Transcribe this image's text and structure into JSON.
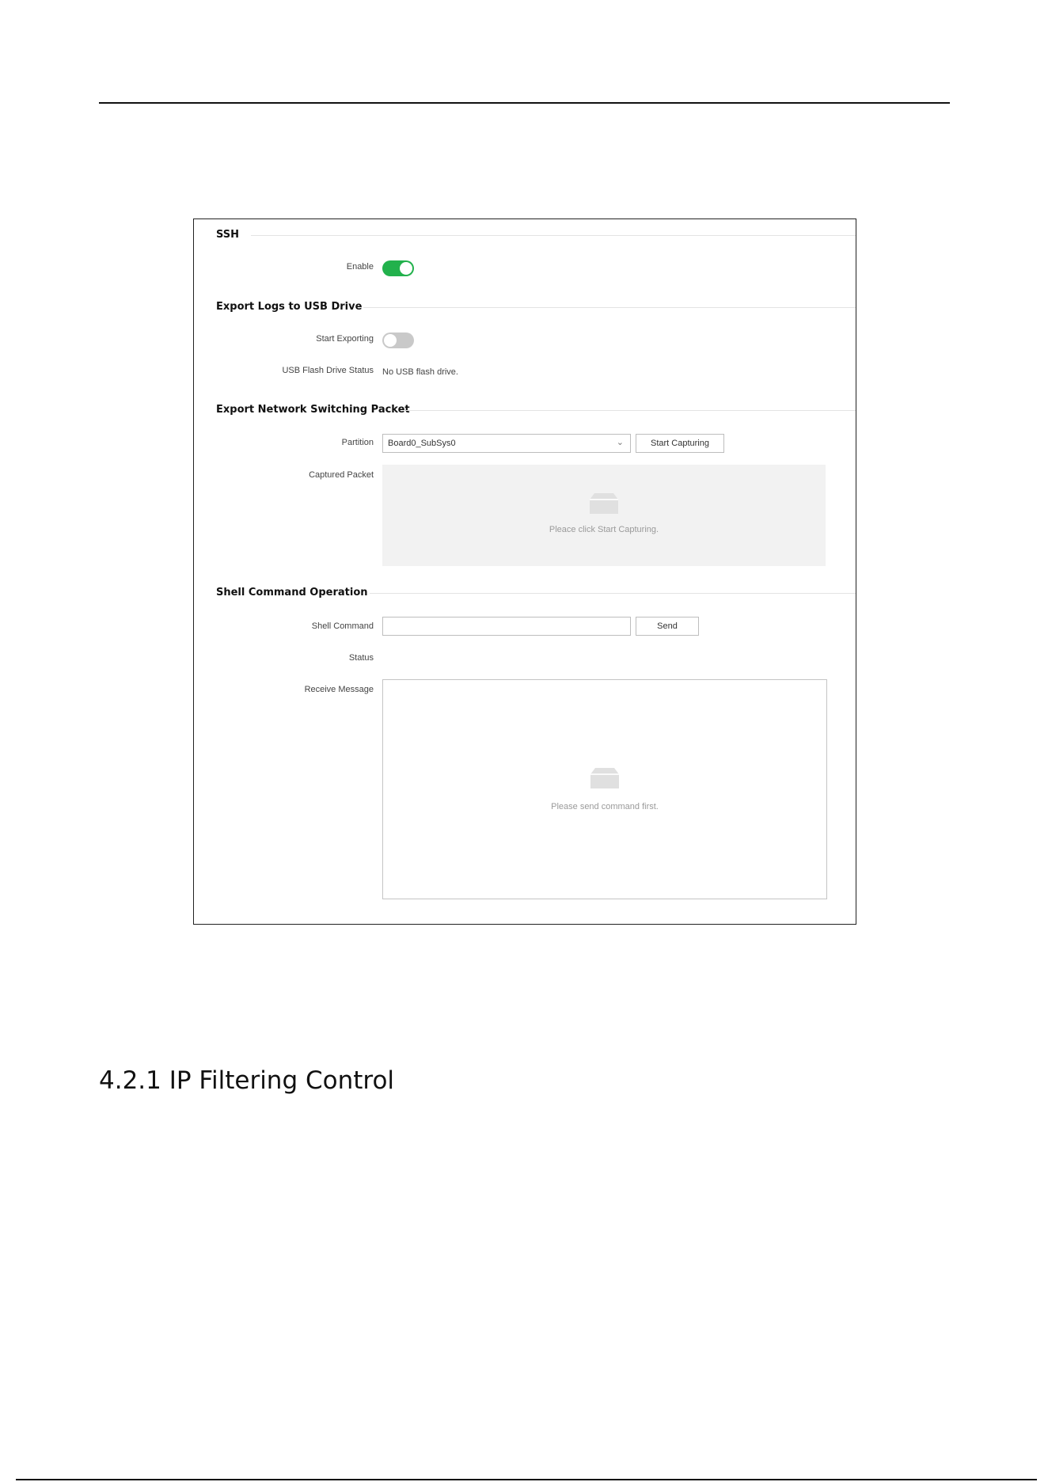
{
  "figure": {
    "ssh": {
      "title": "SSH",
      "enable_label": "Enable",
      "enable_state": "on"
    },
    "export_logs": {
      "title": "Export Logs to USB Drive",
      "start_exporting_label": "Start Exporting",
      "start_exporting_state": "off",
      "usb_status_label": "USB Flash Drive Status",
      "usb_status_value": "No USB flash drive."
    },
    "export_packet": {
      "title": "Export Network Switching Packet",
      "partition_label": "Partition",
      "partition_value": "Board0_SubSys0",
      "start_capturing_label": "Start Capturing",
      "captured_packet_label": "Captured Packet",
      "captured_packet_empty": "Pleace click Start Capturing."
    },
    "shell": {
      "title": "Shell Command Operation",
      "command_label": "Shell Command",
      "command_value": "",
      "send_label": "Send",
      "status_label": "Status",
      "receive_label": "Receive Message",
      "receive_empty": "Please send command first."
    }
  },
  "heading": "4.2.1 IP Filtering Control",
  "colors": {
    "toggle_on": "#22b14c",
    "toggle_off": "#c9c9c9",
    "empty_panel": "#f2f2f2"
  }
}
